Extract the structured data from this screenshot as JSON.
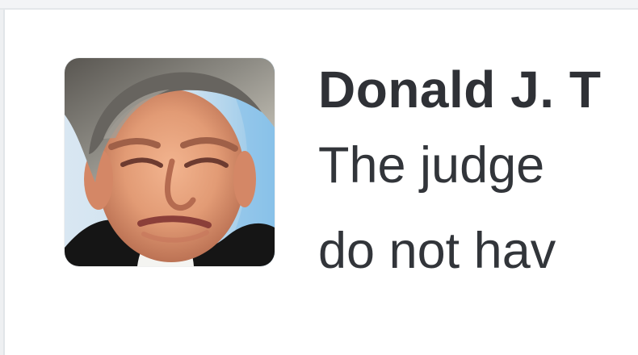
{
  "tweet": {
    "author_name": "Donald J. T",
    "avatar_icon": "profile-photo-icon",
    "text_lines": [
      "The judge",
      "do not hav"
    ]
  },
  "colors": {
    "background": "#ffffff",
    "border": "#e1e5e8",
    "text": "#32353a"
  }
}
